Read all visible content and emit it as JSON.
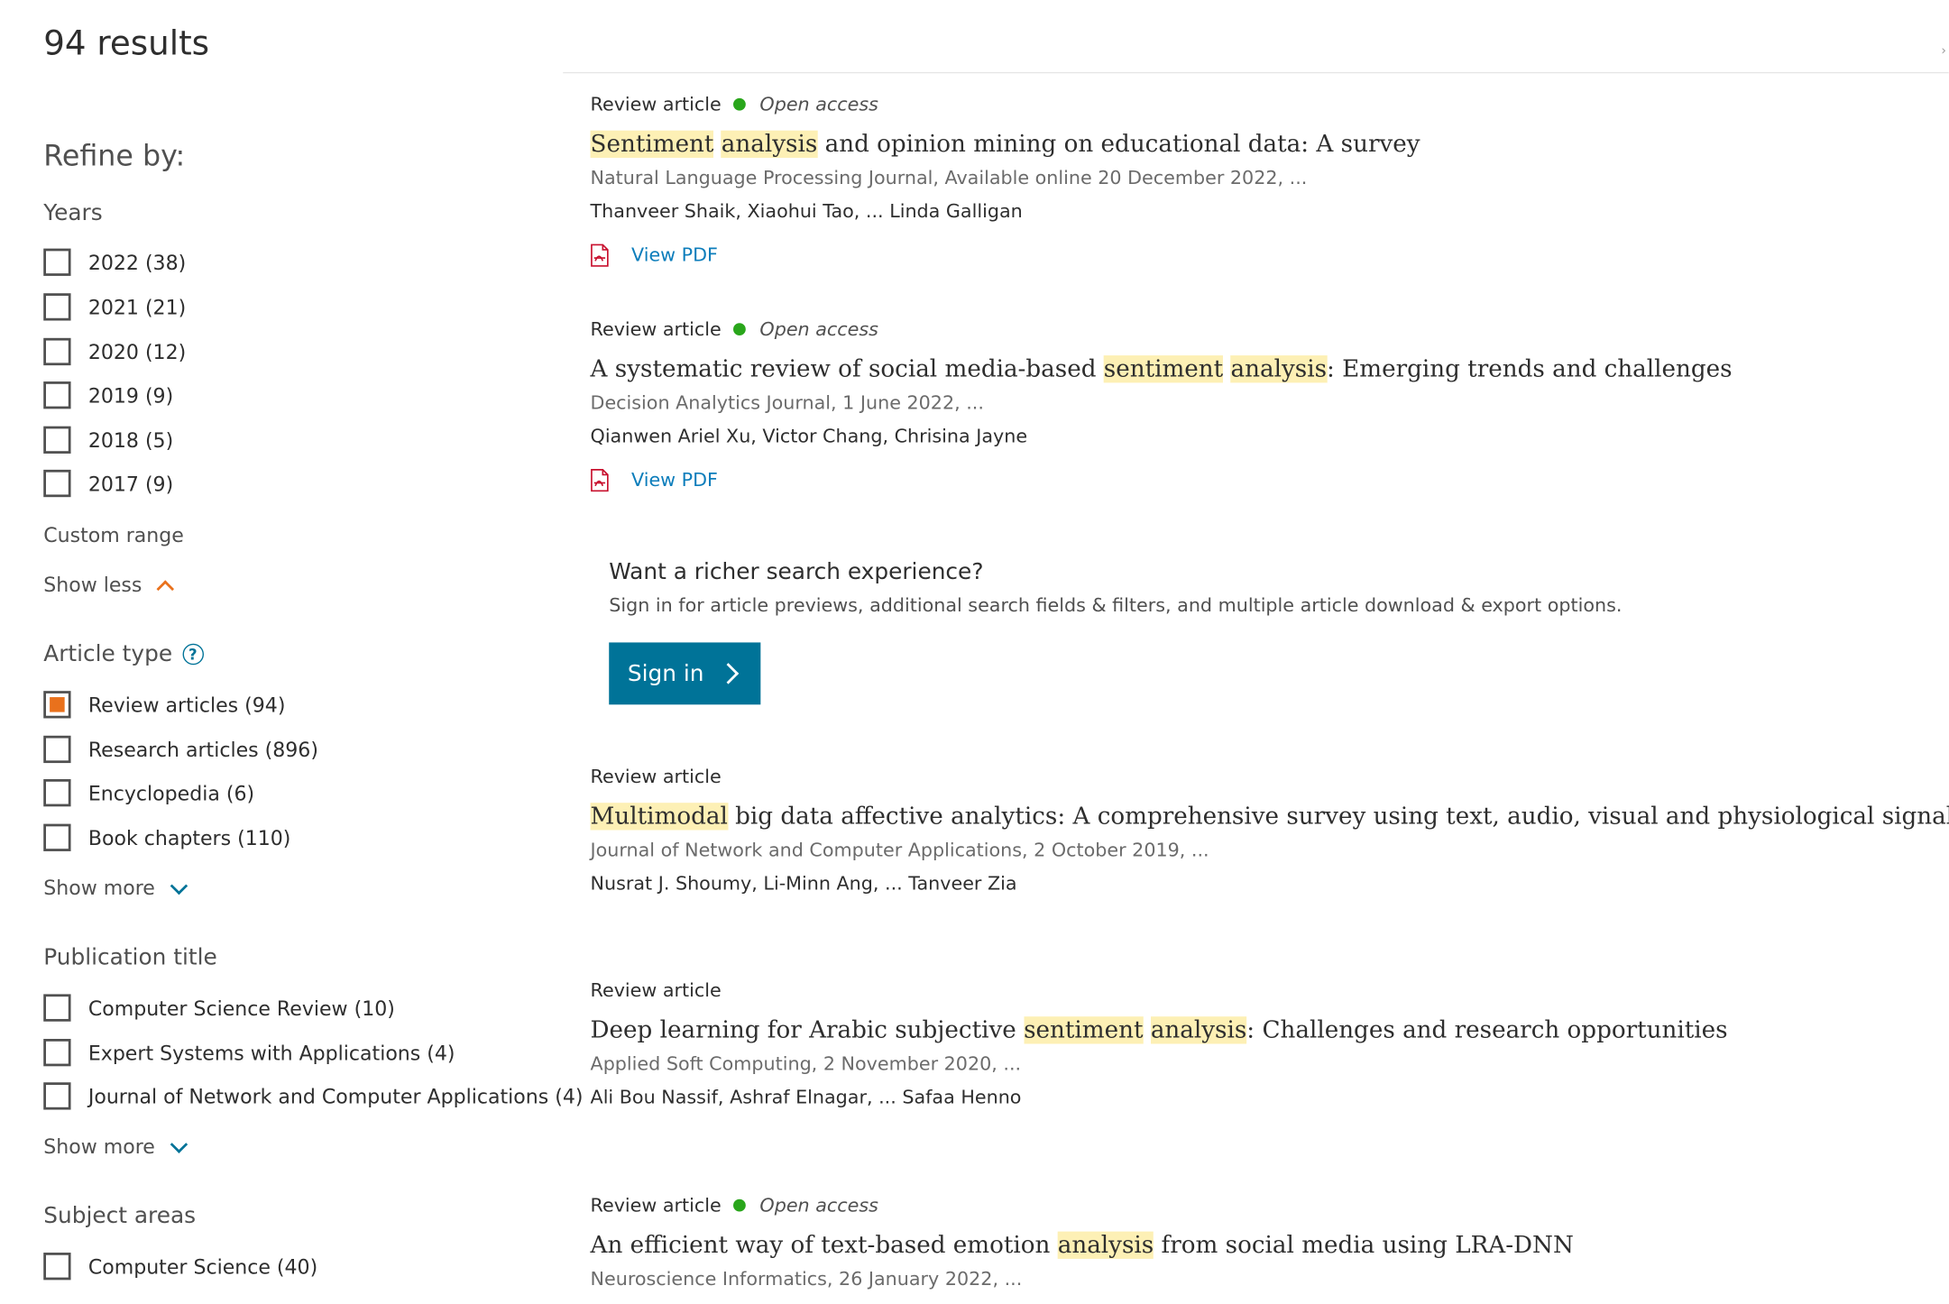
{
  "header": {
    "results_count": "94 results"
  },
  "filters": {
    "title": "Refine by:",
    "years": {
      "label": "Years",
      "options": [
        {
          "label": "2022 (38)",
          "checked": false
        },
        {
          "label": "2021 (21)",
          "checked": false
        },
        {
          "label": "2020 (12)",
          "checked": false
        },
        {
          "label": "2019 (9)",
          "checked": false
        },
        {
          "label": "2018 (5)",
          "checked": false
        },
        {
          "label": "2017 (9)",
          "checked": false
        }
      ],
      "custom_range": "Custom range",
      "show_less": "Show less"
    },
    "article_type": {
      "label": "Article type",
      "help_icon": "?",
      "options": [
        {
          "label": "Review articles (94)",
          "checked": true
        },
        {
          "label": "Research articles (896)",
          "checked": false
        },
        {
          "label": "Encyclopedia (6)",
          "checked": false
        },
        {
          "label": "Book chapters (110)",
          "checked": false
        }
      ],
      "show_more": "Show more"
    },
    "publication_title": {
      "label": "Publication title",
      "options": [
        {
          "label": "Computer Science Review (10)",
          "checked": false
        },
        {
          "label": "Expert Systems with Applications (4)",
          "checked": false
        },
        {
          "label": "Journal of Network and Computer Applications (4)",
          "checked": false
        }
      ],
      "show_more": "Show more"
    },
    "subject_areas": {
      "label": "Subject areas",
      "options": [
        {
          "label": "Computer Science (40)",
          "checked": false
        }
      ]
    }
  },
  "results": [
    {
      "type": "Review article",
      "open_access": "Open access",
      "title_parts": [
        {
          "text": "Sentiment",
          "hl": true
        },
        {
          "text": " ",
          "hl": false
        },
        {
          "text": "analysis",
          "hl": true
        },
        {
          "text": " and opinion mining on educational data: A survey",
          "hl": false
        }
      ],
      "source": "Natural Language Processing Journal, Available online 20 December 2022, ...",
      "authors": "Thanveer Shaik, Xiaohui Tao, ... Linda Galligan",
      "pdf_label": "View PDF"
    },
    {
      "type": "Review article",
      "open_access": "Open access",
      "title_parts": [
        {
          "text": "A systematic review of social media-based ",
          "hl": false
        },
        {
          "text": "sentiment",
          "hl": true
        },
        {
          "text": " ",
          "hl": false
        },
        {
          "text": "analysis",
          "hl": true
        },
        {
          "text": ": Emerging trends and challenges",
          "hl": false
        }
      ],
      "source": "Decision Analytics Journal, 1 June 2022, ...",
      "authors": "Qianwen Ariel Xu, Victor Chang, Chrisina Jayne",
      "pdf_label": "View PDF"
    },
    {
      "type": "Review article",
      "open_access": "",
      "title_parts": [
        {
          "text": "Multimodal",
          "hl": true
        },
        {
          "text": " big data affective analytics: A comprehensive survey using text, audio, visual and physiological signals",
          "hl": false
        }
      ],
      "source": "Journal of Network and Computer Applications, 2 October 2019, ...",
      "authors": "Nusrat J. Shoumy, Li-Minn Ang, ... Tanveer Zia",
      "pdf_label": ""
    },
    {
      "type": "Review article",
      "open_access": "",
      "title_parts": [
        {
          "text": "Deep learning for Arabic subjective ",
          "hl": false
        },
        {
          "text": "sentiment",
          "hl": true
        },
        {
          "text": " ",
          "hl": false
        },
        {
          "text": "analysis",
          "hl": true
        },
        {
          "text": ": Challenges and research opportunities",
          "hl": false
        }
      ],
      "source": "Applied Soft Computing, 2 November 2020, ...",
      "authors": "Ali Bou Nassif, Ashraf Elnagar, ... Safaa Henno",
      "pdf_label": ""
    },
    {
      "type": "Review article",
      "open_access": "Open access",
      "title_parts": [
        {
          "text": "An efficient way of text-based emotion ",
          "hl": false
        },
        {
          "text": "analysis",
          "hl": true
        },
        {
          "text": " from social media using LRA-DNN",
          "hl": false
        }
      ],
      "source": "Neuroscience Informatics, 26 January 2022, ...",
      "authors": "",
      "pdf_label": ""
    }
  ],
  "promo": {
    "title": "Want a richer search experience?",
    "subtitle": "Sign in for article previews, additional search fields & filters, and multiple article download & export options.",
    "button_label": "Sign in"
  },
  "icons": {
    "open_access": "green-dot-icon",
    "pdf": "pdf-file-icon",
    "help": "help-circle-icon",
    "show_less": "chevron-up-icon",
    "show_more": "chevron-down-icon",
    "signin_arrow": "chevron-right-icon"
  },
  "colors": {
    "accent_blue": "#007398",
    "link_blue": "#0c7dbb",
    "checkbox_checked": "#e9711c",
    "highlight": "#fdf0b5",
    "open_access_green": "#29a61b"
  }
}
